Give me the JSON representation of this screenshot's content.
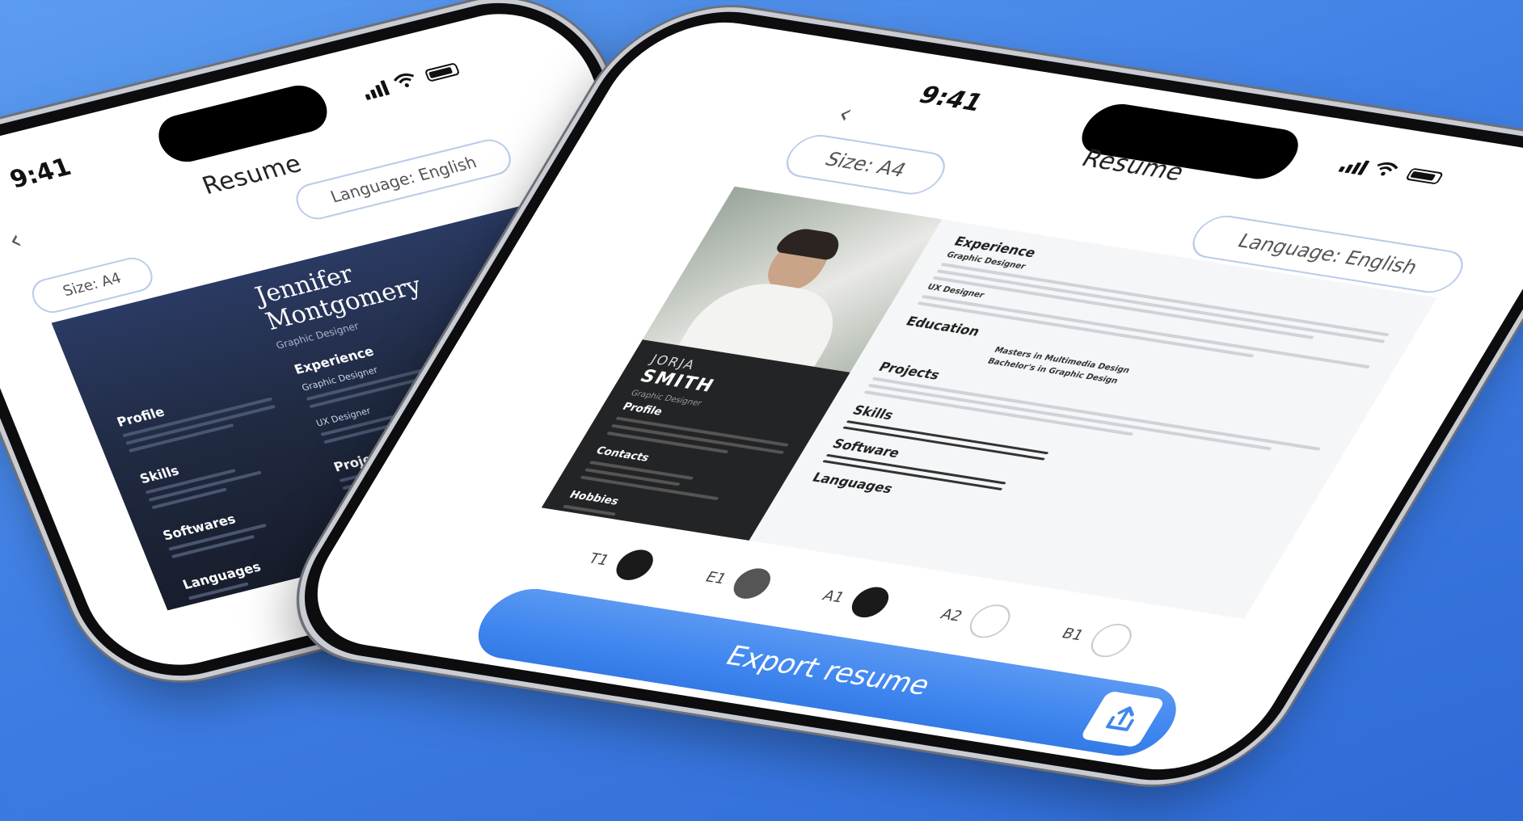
{
  "back_phone": {
    "time": "9:41",
    "title": "Resume",
    "back_icon": "chevron-left-icon",
    "size_label": "Size: A4",
    "language_label": "Language: English",
    "resume": {
      "name": "Jennifer Montgomery",
      "role": "Graphic Designer",
      "sections": [
        "Profile",
        "Skills",
        "Softwares",
        "Languages"
      ],
      "right_sections": [
        "Experience",
        "Projects"
      ],
      "experience_titles": [
        "Graphic Designer",
        "UX Designer"
      ],
      "theme": "#1f2940"
    },
    "template_label": "T1"
  },
  "front_phone": {
    "time": "9:41",
    "title": "Resume",
    "back_icon": "chevron-left-icon",
    "size_label": "Size: A4",
    "language_label": "Language: English",
    "resume": {
      "first_name": "JORJA",
      "last_name": "SMITH",
      "role": "Graphic Designer",
      "left_sections": [
        "Profile",
        "Contacts",
        "Hobbies"
      ],
      "right_sections": [
        "Experience",
        "Education",
        "Projects",
        "Skills",
        "Software",
        "Languages"
      ],
      "experience_titles": [
        "Graphic Designer",
        "UX Designer"
      ],
      "education_titles": [
        "Masters in Multimedia Design",
        "Bachelor's in Graphic Design"
      ]
    },
    "templates": [
      {
        "label": "T1",
        "color": "#1a1a1a"
      },
      {
        "label": "E1",
        "color": "#555555"
      },
      {
        "label": "A1",
        "color": "#1a1a1a"
      },
      {
        "label": "A2",
        "color": "#ffffff"
      },
      {
        "label": "B1",
        "color": "#ffffff"
      }
    ],
    "export_label": "Export resume",
    "export_icon": "share-icon",
    "accent": "#3f86ef"
  }
}
